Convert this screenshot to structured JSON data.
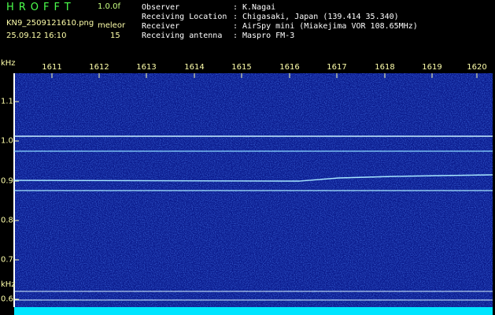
{
  "app": {
    "name": "HROFFT",
    "version": "1.0.0f"
  },
  "image": {
    "file_name": "KN9_2509121610.png",
    "timestamp": "25.09.12 16:10"
  },
  "display": {
    "mode_label": "meleor",
    "mode_value": "15"
  },
  "info": [
    {
      "key": "Observer",
      "value": "K.Nagai"
    },
    {
      "key": "Receiving Location",
      "value": "Chigasaki, Japan (139.414 35.340)"
    },
    {
      "key": "Receiver",
      "value": "AirSpy mini (Miakejima VOR 108.65MHz)"
    },
    {
      "key": "Receiving antenna",
      "value": "Maspro FM-3"
    }
  ],
  "axes": {
    "freq_unit": "kHz",
    "freq_unit_bottom": "kHz",
    "time_labels": [
      "1611",
      "1612",
      "1613",
      "1614",
      "1615",
      "1616",
      "1617",
      "1618",
      "1619",
      "1620"
    ],
    "freq_labels": [
      "1.1",
      "1.0",
      "0.9",
      "0.8",
      "0.7",
      "0.6"
    ]
  },
  "colors": {
    "background": "#000000",
    "spectrogram_base": "#0a1a8c",
    "signal_line": "#a8e8ff",
    "bottom_band": "#00e5ff",
    "label": "#ffffaa",
    "header_text": "#ffffff",
    "title": "#4cff4c"
  }
}
